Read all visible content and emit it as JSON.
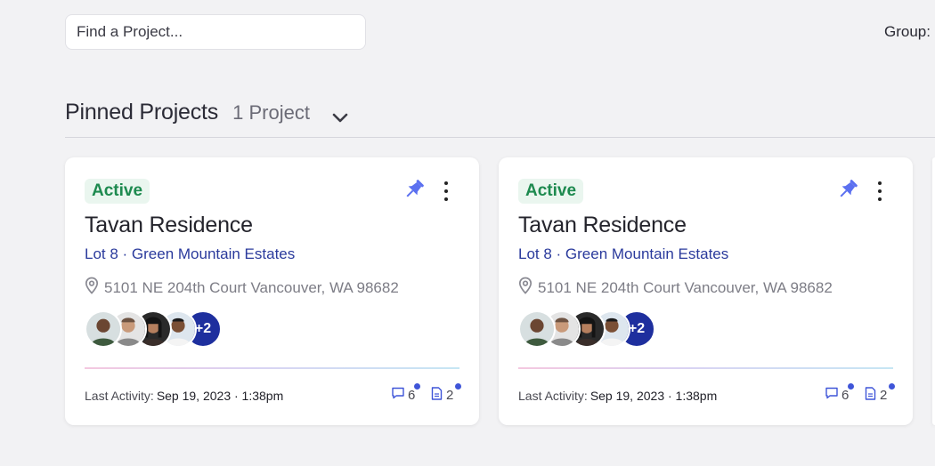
{
  "search": {
    "placeholder": "Find a Project..."
  },
  "toolbar": {
    "group_label": "Group:"
  },
  "section": {
    "title": "Pinned Projects",
    "count": "1 Project"
  },
  "colors": {
    "accent": "#1e2f9e",
    "status_active": "#1d8a4f",
    "pin": "#5b70f0",
    "notification_dot": "#3f55d8"
  },
  "cards": [
    {
      "status": "Active",
      "title": "Tavan Residence",
      "subtitle": "Lot 8 · Green Mountain Estates",
      "address": "5101 NE 204th Court Vancouver, WA 98682",
      "avatar_more": "+2",
      "last_activity_label": "Last Activity:",
      "last_activity_date": "Sep 19, 2023 · 1:38pm",
      "comments": "6",
      "files": "2"
    },
    {
      "status": "Active",
      "title": "Tavan Residence",
      "subtitle": "Lot 8 · Green Mountain Estates",
      "address": "5101 NE 204th Court Vancouver, WA 98682",
      "avatar_more": "+2",
      "last_activity_label": "Last Activity:",
      "last_activity_date": "Sep 19, 2023 · 1:38pm",
      "comments": "6",
      "files": "2"
    }
  ]
}
